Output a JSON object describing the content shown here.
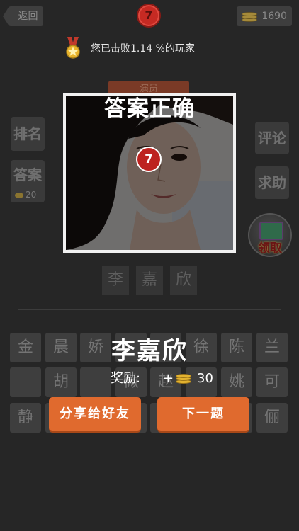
{
  "top_bar": {
    "back_label": "返回",
    "level": "7",
    "coins": "1690"
  },
  "beat": {
    "text": "您已击败1.14 %的玩家"
  },
  "side_left": {
    "rank_label": "排名",
    "answer_label": "答案",
    "answer_cost": "20"
  },
  "side_right": {
    "comment_label": "评论",
    "help_label": "求助",
    "reward_label": "领取"
  },
  "photo": {
    "tag": "演员"
  },
  "result": {
    "title": "答案正确",
    "level_badge": "7",
    "answer": "李嘉欣",
    "reward_prefix": "奖励:",
    "reward_plus": "+",
    "reward_amount": "30",
    "share_button": "分享给好友",
    "next_button": "下一题"
  },
  "answer_slots": [
    "李",
    "嘉",
    "欣"
  ],
  "candidates": {
    "row1": [
      "金",
      "晨",
      "娇",
      "",
      "",
      "徐",
      "陈",
      "兰"
    ],
    "row2": [
      "",
      "胡",
      "",
      "微",
      "赵",
      "",
      "姚",
      "可"
    ],
    "row3": [
      "静",
      "",
      "",
      "",
      "",
      "",
      "",
      "俪"
    ]
  },
  "colors": {
    "background": "#262626",
    "accent_orange": "#e06a2e",
    "badge_red": "#c62a23"
  }
}
